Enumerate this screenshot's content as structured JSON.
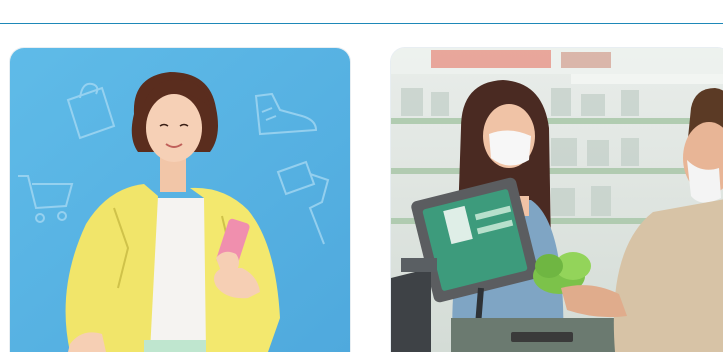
{
  "header": {
    "accent_color": "#1e88b8"
  },
  "cards": [
    {
      "image": "woman-yellow-jacket-shopping-on-phone",
      "background_color": "#5bb8e6",
      "decor_icons": [
        "shopping-bag-icon",
        "shopping-cart-icon",
        "sneaker-icon",
        "paint-roller-icon"
      ]
    },
    {
      "image": "supermarket-checkout-masked-cashier-and-customer",
      "background_color": "#dfe6e3"
    }
  ]
}
